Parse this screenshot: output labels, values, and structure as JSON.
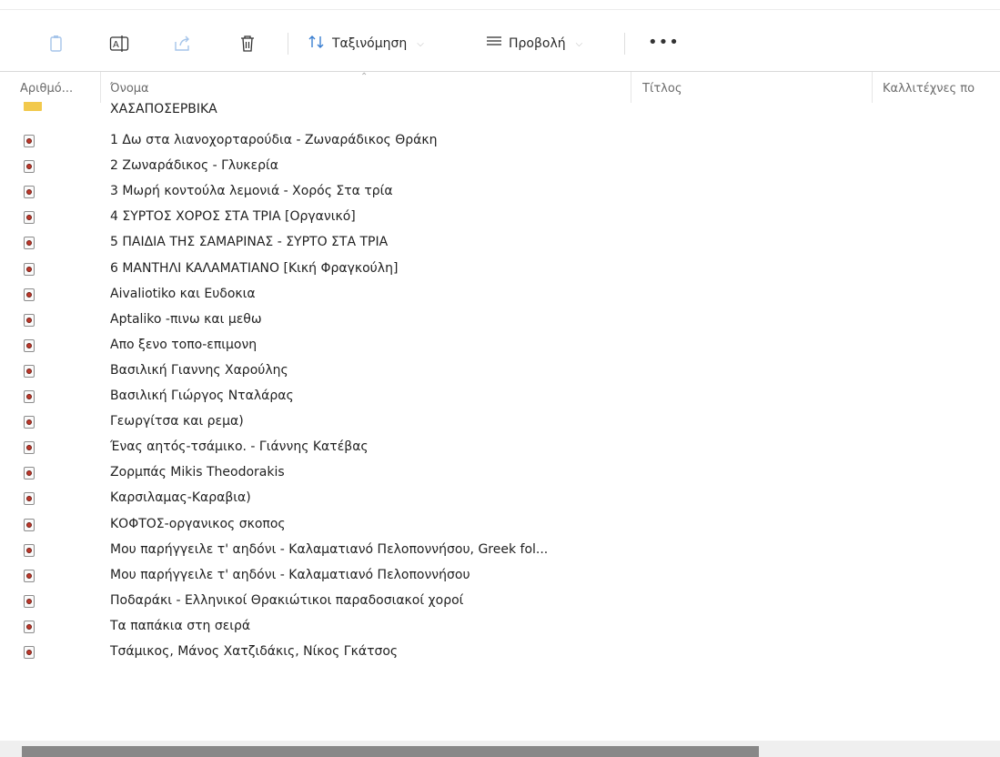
{
  "toolbar": {
    "copy_icon": "copy-icon",
    "rename_icon": "rename-icon",
    "share_icon": "share-icon",
    "delete_icon": "trash-icon",
    "sort_label": "Ταξινόμηση",
    "view_label": "Προβολή",
    "more_label": "•••"
  },
  "columns": {
    "number": "Αριθμό...",
    "name": "Όνομα",
    "title": "Τίτλος",
    "artists": "Καλλιτέχνες πο"
  },
  "folder_row": {
    "name": "ΧΑΣΑΠΟΣΕΡΒΙΚΑ"
  },
  "files": [
    "1 Δω στα λιανοχορταρούδια - Ζωναράδικος Θράκη",
    "2 Ζωναράδικος - Γλυκερία",
    "3 Μωρή κοντούλα λεμονιά - Χορός Στα τρία",
    "4 ΣΥΡΤΟΣ ΧΟΡΟΣ ΣΤΑ ΤΡΙΑ [Οργανικό]",
    "5 ΠΑΙΔΙΑ ΤΗΣ ΣΑΜΑΡΙΝΑΣ - ΣΥΡΤΟ ΣΤΑ ΤΡΙΑ",
    "6 ΜΑΝΤΗΛΙ ΚΑΛΑΜΑΤΙΑΝΟ [Κική Φραγκούλη]",
    "Aivaliotiko και Ευδοκια",
    "Aptaliko -πινω και μεθω",
    "Απο ξενο τοπο-επιμονη",
    "Βασιλική Γιαννης Χαρούλης",
    "Βασιλική Γιώργος Νταλάρας",
    "Γεωργίτσα και ρεμα)",
    "Ένας αητός-τσάμικο. - Γιάννης Κατέβας",
    "Ζορμπάς  Mikis Theodorakis",
    "Καρσιλαμας-Καραβια)",
    "ΚΟΦΤΟΣ-οργανικος σκοπος",
    "Μου παρήγγειλε τ' αηδόνι - Καλαματιανό Πελοποννήσου, Greek fol...",
    "Μου παρήγγειλε τ' αηδόνι - Καλαματιανό Πελοποννήσου",
    "Ποδαράκι - Ελληνικοί Θρακιώτικοι παραδοσιακοί χοροί",
    "Τα παπάκια στη σειρά",
    "Τσάμικος, Μάνος Χατζιδάκις, Νίκος Γκάτσος"
  ],
  "file_icon": "audio-file-icon",
  "folder_icon": "folder-icon"
}
